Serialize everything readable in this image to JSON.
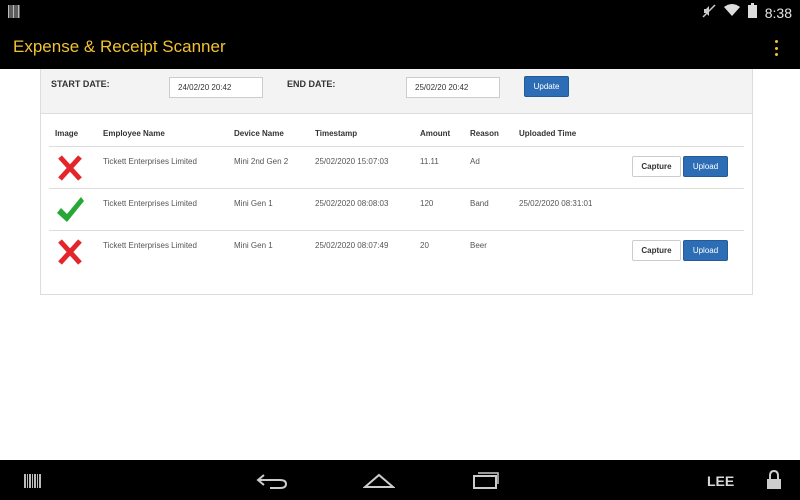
{
  "status_bar": {
    "time": "8:38",
    "icons": [
      "barcode-notification-icon",
      "mute-icon",
      "wifi-icon",
      "battery-icon"
    ]
  },
  "app": {
    "title": "Expense & Receipt Scanner",
    "title_color": "#f2c230"
  },
  "filter": {
    "start_label": "START DATE:",
    "start_value": "24/02/20 20:42",
    "end_label": "END DATE:",
    "end_value": "25/02/20 20:42",
    "update_label": "Update"
  },
  "table": {
    "headers": {
      "image": "Image",
      "employee": "Employee Name",
      "device": "Device Name",
      "timestamp": "Timestamp",
      "amount": "Amount",
      "reason": "Reason",
      "uploaded": "Uploaded Time"
    },
    "rows": [
      {
        "status_icon": "cross-icon",
        "employee": "Tickett Enterprises Limited",
        "device": "Mini 2nd Gen 2",
        "timestamp": "25/02/2020 15:07:03",
        "amount": "11.11",
        "reason": "Ad",
        "uploaded": "",
        "capture_label": "Capture",
        "upload_label": "Upload"
      },
      {
        "status_icon": "check-icon",
        "employee": "Tickett Enterprises Limited",
        "device": "Mini Gen 1",
        "timestamp": "25/02/2020 08:08:03",
        "amount": "120",
        "reason": "Band",
        "uploaded": "25/02/2020 08:31:01"
      },
      {
        "status_icon": "cross-icon",
        "employee": "Tickett Enterprises Limited",
        "device": "Mini Gen 1",
        "timestamp": "25/02/2020 08:07:49",
        "amount": "20",
        "reason": "Beer",
        "uploaded": "",
        "capture_label": "Capture",
        "upload_label": "Upload"
      }
    ]
  },
  "nav_bar": {
    "user_label": "LEE",
    "icons": [
      "barcode-icon",
      "back-icon",
      "home-icon",
      "recents-icon",
      "lock-icon"
    ]
  },
  "colors": {
    "accent_blue": "#2d6db5",
    "cross_red": "#e3262b",
    "check_green": "#27a836"
  }
}
